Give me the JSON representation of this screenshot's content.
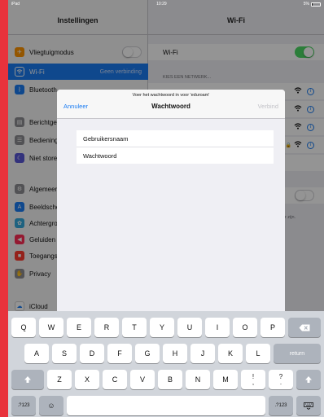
{
  "statusbar": {
    "device": "iPad",
    "time": "10:29",
    "battery": "5%"
  },
  "master": {
    "title": "Instellingen",
    "rows": [
      {
        "label": "Vliegtuigmodus",
        "icon": "airplane-icon",
        "color": "#ff9500"
      },
      {
        "label": "Wi-Fi",
        "value": "Geen verbinding",
        "icon": "wifi-icon",
        "color": "#1a7cf3"
      },
      {
        "label": "Bluetooth",
        "icon": "bluetooth-icon",
        "color": "#1a7cf3"
      },
      {
        "label": "Berichtgeving",
        "icon": "notifications-icon",
        "color": "#8e8e93"
      },
      {
        "label": "Bedieningspaneel",
        "icon": "control-center-icon",
        "color": "#8e8e93"
      },
      {
        "label": "Niet storen",
        "icon": "moon-icon",
        "color": "#5856d6"
      },
      {
        "label": "Algemeen",
        "icon": "gear-icon",
        "color": "#8e8e93"
      },
      {
        "label": "Beeldscherm",
        "icon": "display-icon",
        "color": "#1a7cf3"
      },
      {
        "label": "Achtergrond",
        "icon": "wallpaper-icon",
        "color": "#34aadc"
      },
      {
        "label": "Geluiden",
        "icon": "sound-icon",
        "color": "#ff2d55"
      },
      {
        "label": "Toegangscode",
        "icon": "lock-icon",
        "color": "#ff3b30"
      },
      {
        "label": "Privacy",
        "icon": "hand-icon",
        "color": "#8e8e93"
      },
      {
        "label": "iCloud",
        "icon": "cloud-icon",
        "color": "#ffffff"
      }
    ]
  },
  "detail": {
    "title": "Wi-Fi",
    "wifi_label": "Wi-Fi",
    "network_header": "KIES EEN NETWERK...",
    "footnote_1": "ende",
    "footnote_2": "kbaar zijn."
  },
  "modal": {
    "prompt": "Voer het wachtwoord in voor 'eduroam'",
    "cancel": "Annuleer",
    "title": "Wachtwoord",
    "connect": "Verbind",
    "username_placeholder": "Gebruikersnaam",
    "password_placeholder": "Wachtwoord"
  },
  "keyboard": {
    "row1": [
      "Q",
      "W",
      "E",
      "R",
      "T",
      "Y",
      "U",
      "I",
      "O",
      "P"
    ],
    "row2": [
      "A",
      "S",
      "D",
      "F",
      "G",
      "H",
      "J",
      "K",
      "L"
    ],
    "row3": [
      "Z",
      "X",
      "C",
      "V",
      "B",
      "N",
      "M"
    ],
    "excl_top": "!",
    "excl_bottom": ",",
    "quest_top": "?",
    "quest_bottom": ".",
    "return": "return",
    "numbers_left": ".?123",
    "numbers_right": ".?123"
  }
}
